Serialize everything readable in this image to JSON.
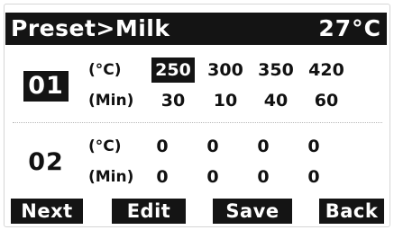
{
  "header": {
    "title": "Preset>Milk",
    "temperature": "27°C"
  },
  "presets": [
    {
      "id": "01",
      "selected": true,
      "temp_unit": "(°C)",
      "time_unit": "(Min)",
      "temps": [
        "250",
        "300",
        "350",
        "420"
      ],
      "times": [
        "30",
        "10",
        "40",
        "60"
      ],
      "highlighted_temp_index": 0
    },
    {
      "id": "02",
      "selected": false,
      "temp_unit": "(°C)",
      "time_unit": "(Min)",
      "temps": [
        "0",
        "0",
        "0",
        "0"
      ],
      "times": [
        "0",
        "0",
        "0",
        "0"
      ]
    }
  ],
  "softkeys": {
    "next": "Next",
    "edit": "Edit",
    "save": "Save",
    "back": "Back"
  },
  "colors": {
    "inverse_background": "#141414",
    "screen_background": "#ffffff"
  }
}
